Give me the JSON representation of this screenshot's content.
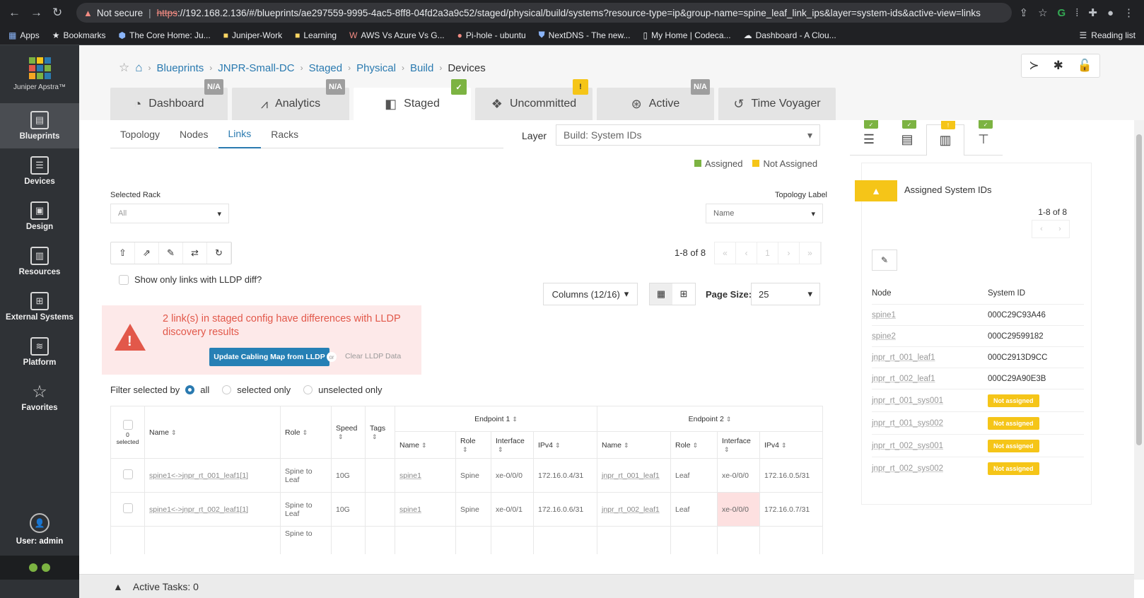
{
  "browser": {
    "not_secure": "Not secure",
    "url_https": "https",
    "url_rest": "://192.168.2.136/#/blueprints/ae297559-9995-4ac5-8ff8-04fd2a3a9c52/staged/physical/build/systems?resource-type=ip&group-name=spine_leaf_link_ips&layer=system-ids&active-view=links",
    "bookmarks": [
      "Apps",
      "Bookmarks",
      "The Core Home: Ju...",
      "Juniper-Work",
      "Learning",
      "AWS Vs Azure Vs G...",
      "Pi-hole - ubuntu",
      "NextDNS - The new...",
      "My Home | Codeca...",
      "Dashboard - A Clou..."
    ],
    "reading_list": "Reading list"
  },
  "sidebar": {
    "logo_text": "Juniper Apstra™",
    "items": [
      "Blueprints",
      "Devices",
      "Design",
      "Resources",
      "External Systems",
      "Platform",
      "Favorites"
    ],
    "user": "User: admin"
  },
  "breadcrumb": [
    "Blueprints",
    "JNPR-Small-DC",
    "Staged",
    "Physical",
    "Build",
    "Devices"
  ],
  "tabs": [
    {
      "label": "Dashboard",
      "badge": "N/A"
    },
    {
      "label": "Analytics",
      "badge": "N/A"
    },
    {
      "label": "Staged",
      "badge": "✓"
    },
    {
      "label": "Uncommitted",
      "badge": "!"
    },
    {
      "label": "Active",
      "badge": "N/A"
    },
    {
      "label": "Time Voyager",
      "badge": ""
    }
  ],
  "subtabs": [
    "Topology",
    "Nodes",
    "Links",
    "Racks"
  ],
  "layer": {
    "label": "Layer",
    "value": "Build: System IDs"
  },
  "legend": {
    "assigned": "Assigned",
    "not_assigned": "Not Assigned"
  },
  "selected_rack": {
    "label": "Selected Rack",
    "value": "All"
  },
  "topology_label": {
    "label": "Topology Label",
    "value": "Name"
  },
  "pager": {
    "count": "1-8 of 8",
    "page": "1"
  },
  "lldp_checkbox": "Show only links with LLDP diff?",
  "columns_btn": "Columns (12/16)",
  "page_size": {
    "label": "Page Size:",
    "value": "25"
  },
  "alert": {
    "message": "2 link(s) in staged config have differences with LLDP discovery results",
    "button": "Update Cabling Map from LLDP",
    "or": "or",
    "clear": "Clear LLDP Data"
  },
  "filter": {
    "label": "Filter selected by",
    "all": "all",
    "selected": "selected only",
    "unselected": "unselected only"
  },
  "table": {
    "selected": "0 selected",
    "headers": {
      "name": "Name",
      "role": "Role",
      "speed": "Speed",
      "tags": "Tags",
      "ep1": "Endpoint 1",
      "ep2": "Endpoint 2",
      "ep_name": "Name",
      "ep_role": "Role",
      "ep_iface": "Interface",
      "ep_ipv4": "IPv4"
    },
    "rows": [
      {
        "name": "spine1<->jnpr_rt_001_leaf1[1]",
        "role": "Spine to Leaf",
        "speed": "10G",
        "tags": "",
        "e1_name": "spine1",
        "e1_role": "Spine",
        "e1_iface": "xe-0/0/0",
        "e1_ip": "172.16.0.4/31",
        "e2_name": "jnpr_rt_001_leaf1",
        "e2_role": "Leaf",
        "e2_iface": "xe-0/0/0",
        "e2_ip": "172.16.0.5/31"
      },
      {
        "name": "spine1<->jnpr_rt_002_leaf1[1]",
        "role": "Spine to Leaf",
        "speed": "10G",
        "tags": "",
        "e1_name": "spine1",
        "e1_role": "Spine",
        "e1_iface": "xe-0/0/1",
        "e1_ip": "172.16.0.6/31",
        "e2_name": "jnpr_rt_002_leaf1",
        "e2_role": "Leaf",
        "e2_iface": "xe-0/0/0",
        "e2_ip": "172.16.0.7/31"
      },
      {
        "name": "",
        "role": "Spine to",
        "speed": "",
        "tags": "",
        "e1_name": "",
        "e1_role": "",
        "e1_iface": "",
        "e1_ip": "",
        "e2_name": "",
        "e2_role": "",
        "e2_iface": "",
        "e2_ip": ""
      }
    ]
  },
  "right_panel": {
    "title": "Assigned System IDs",
    "count": "1-8 of 8",
    "col_node": "Node",
    "col_sysid": "System ID",
    "rows": [
      {
        "node": "spine1",
        "sysid": "000C29C93A46"
      },
      {
        "node": "spine2",
        "sysid": "000C29599182"
      },
      {
        "node": "jnpr_rt_001_leaf1",
        "sysid": "000C2913D9CC"
      },
      {
        "node": "jnpr_rt_002_leaf1",
        "sysid": "000C29A90E3B"
      },
      {
        "node": "jnpr_rt_001_sys001",
        "sysid": "Not assigned"
      },
      {
        "node": "jnpr_rt_001_sys002",
        "sysid": "Not assigned"
      },
      {
        "node": "jnpr_rt_002_sys001",
        "sysid": "Not assigned"
      },
      {
        "node": "jnpr_rt_002_sys002",
        "sysid": "Not assigned"
      }
    ]
  },
  "active_tasks": "Active Tasks: 0",
  "colors": {
    "accent": "#2a7ab0",
    "assigned": "#7cb342",
    "not_assigned": "#f5c518",
    "alert": "#e2584a"
  }
}
